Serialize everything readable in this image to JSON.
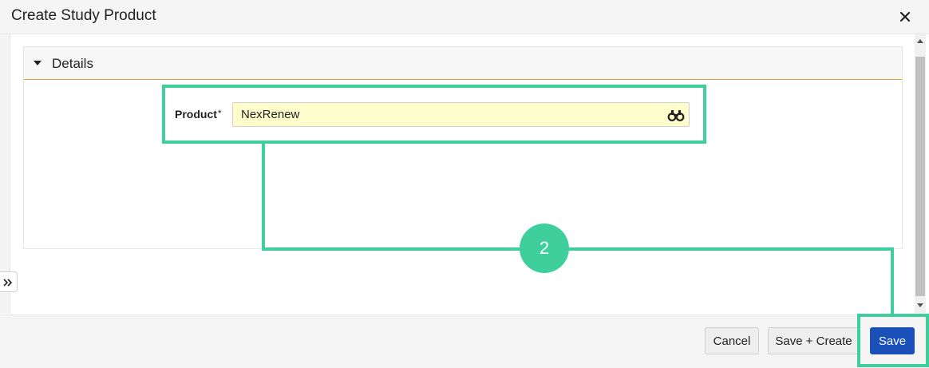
{
  "dialog": {
    "title": "Create Study Product"
  },
  "section": {
    "title": "Details"
  },
  "form": {
    "product_label": "Product",
    "required_marker": "*",
    "product_value": "NexRenew"
  },
  "callout": {
    "step_number": "2"
  },
  "footer": {
    "cancel_label": "Cancel",
    "save_create_label": "Save + Create",
    "save_label": "Save"
  },
  "icons": {
    "close": "close-icon",
    "collapse": "caret-down-icon",
    "lookup": "binoculars-icon",
    "expand": "double-chevron-right-icon",
    "scroll_up": "scroll-up-arrow-icon",
    "scroll_down": "scroll-down-arrow-icon"
  },
  "colors": {
    "primary_button": "#1b50b8",
    "highlight": "#3fcf9c",
    "input_fill": "#fefdcc",
    "section_rule": "#d7a43a"
  }
}
